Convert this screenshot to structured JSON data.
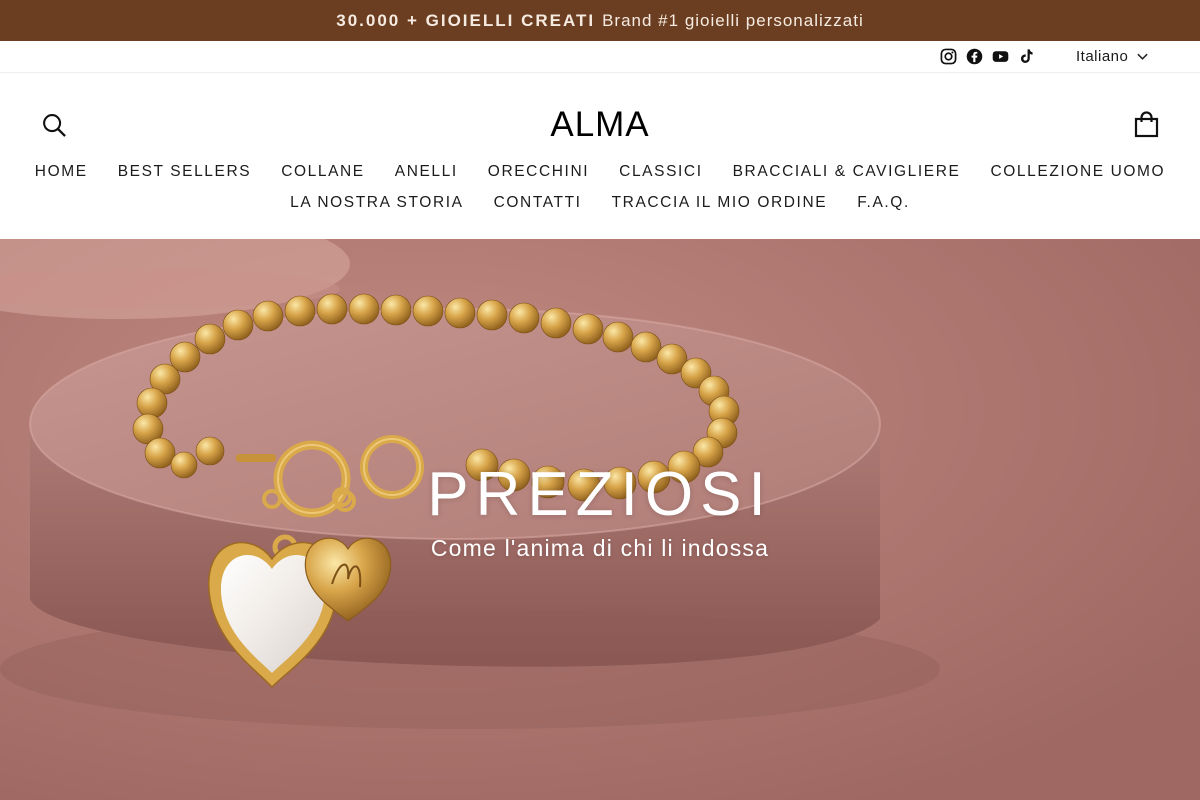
{
  "announcement": {
    "strong": "30.000 + GIOIELLI CREATI",
    "text": "Brand #1 gioielli personalizzati"
  },
  "utility": {
    "socials": [
      "instagram-icon",
      "facebook-icon",
      "youtube-icon",
      "tiktok-icon"
    ],
    "language": "Italiano"
  },
  "header": {
    "logo": "ALMA",
    "nav_row1": [
      "HOME",
      "BEST SELLERS",
      "COLLANE",
      "ANELLI",
      "ORECCHINI",
      "CLASSICI",
      "BRACCIALI & CAVIGLIERE",
      "COLLEZIONE UOMO"
    ],
    "nav_row2": [
      "LA NOSTRA STORIA",
      "CONTATTI",
      "TRACCIA IL MIO ORDINE",
      "F.A.Q."
    ]
  },
  "hero": {
    "title": "PREZIOSI",
    "subtitle": "Come l'anima di chi li indossa"
  },
  "colors": {
    "announcement_bg": "#6b3e22",
    "hero_bg": "#a9706a",
    "gold": "#d9a94a"
  }
}
